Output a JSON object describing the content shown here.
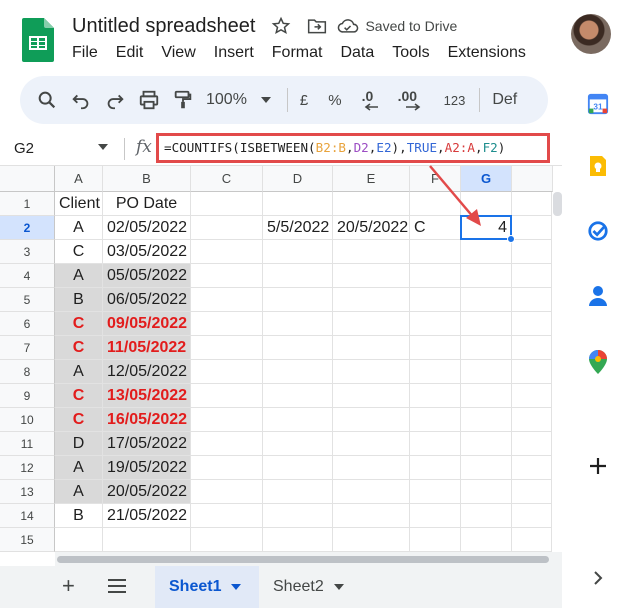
{
  "app": {
    "doc_title": "Untitled spreadsheet",
    "saved_status": "Saved to Drive"
  },
  "menu": [
    "File",
    "Edit",
    "View",
    "Insert",
    "Format",
    "Data",
    "Tools",
    "Extensions"
  ],
  "toolbar": {
    "zoom": "100%",
    "currency": "£",
    "percent": "%",
    "decrease_decimal": ".0",
    "increase_decimal": ".00",
    "number_format": "123",
    "font": "Def"
  },
  "formula_bar": {
    "cell_ref": "G2",
    "fx": "fx",
    "formula_parts": [
      {
        "text": "=COUNTIFS(ISBETWEEN(",
        "color": "#1f1f1f"
      },
      {
        "text": "B2:B",
        "color": "#e8a33c"
      },
      {
        "text": ",",
        "color": "#1f1f1f"
      },
      {
        "text": "D2",
        "color": "#9c4dc4"
      },
      {
        "text": ",",
        "color": "#1f1f1f"
      },
      {
        "text": "E2",
        "color": "#3367d6"
      },
      {
        "text": "),",
        "color": "#1f1f1f"
      },
      {
        "text": "TRUE",
        "color": "#3367d6"
      },
      {
        "text": ",",
        "color": "#1f1f1f"
      },
      {
        "text": "A2:A",
        "color": "#d73b3b"
      },
      {
        "text": ",",
        "color": "#1f1f1f"
      },
      {
        "text": "F2",
        "color": "#1e8e8e"
      },
      {
        "text": ")",
        "color": "#1f1f1f"
      }
    ]
  },
  "grid": {
    "columns": [
      "A",
      "B",
      "C",
      "D",
      "E",
      "F",
      "G"
    ],
    "rows": [
      "1",
      "2",
      "3",
      "4",
      "5",
      "6",
      "7",
      "8",
      "9",
      "10",
      "11",
      "12",
      "13",
      "14",
      "15"
    ],
    "header_row": {
      "A": "Client",
      "B": "PO Date"
    },
    "data": [
      {
        "A": "A",
        "B": "02/05/2022",
        "D": "5/5/2022",
        "E": "20/5/2022",
        "F": "C",
        "G": "4",
        "highlight": false,
        "gray": false
      },
      {
        "A": "C",
        "B": "03/05/2022",
        "highlight": false,
        "gray": false
      },
      {
        "A": "A",
        "B": "05/05/2022",
        "highlight": false,
        "gray": true
      },
      {
        "A": "B",
        "B": "06/05/2022",
        "highlight": false,
        "gray": true
      },
      {
        "A": "C",
        "B": "09/05/2022",
        "highlight": true,
        "gray": true
      },
      {
        "A": "C",
        "B": "11/05/2022",
        "highlight": true,
        "gray": true
      },
      {
        "A": "A",
        "B": "12/05/2022",
        "highlight": false,
        "gray": true
      },
      {
        "A": "C",
        "B": "13/05/2022",
        "highlight": true,
        "gray": true
      },
      {
        "A": "C",
        "B": "16/05/2022",
        "highlight": true,
        "gray": true
      },
      {
        "A": "D",
        "B": "17/05/2022",
        "highlight": false,
        "gray": true
      },
      {
        "A": "A",
        "B": "19/05/2022",
        "highlight": false,
        "gray": true
      },
      {
        "A": "A",
        "B": "20/05/2022",
        "highlight": false,
        "gray": true
      },
      {
        "A": "B",
        "B": "21/05/2022",
        "highlight": false,
        "gray": false
      }
    ],
    "selected_cell": "G2"
  },
  "sheets": {
    "tabs": [
      "Sheet1",
      "Sheet2"
    ],
    "active": "Sheet1"
  },
  "side_panel": [
    "calendar-icon",
    "keep-icon",
    "tasks-icon",
    "contacts-icon",
    "maps-icon",
    "add-icon"
  ],
  "colors": {
    "accent": "#1a73e8",
    "annotation_red": "#e24a4a",
    "highlight_text": "#e21c1c",
    "gray_fill": "#d9d9d9"
  }
}
